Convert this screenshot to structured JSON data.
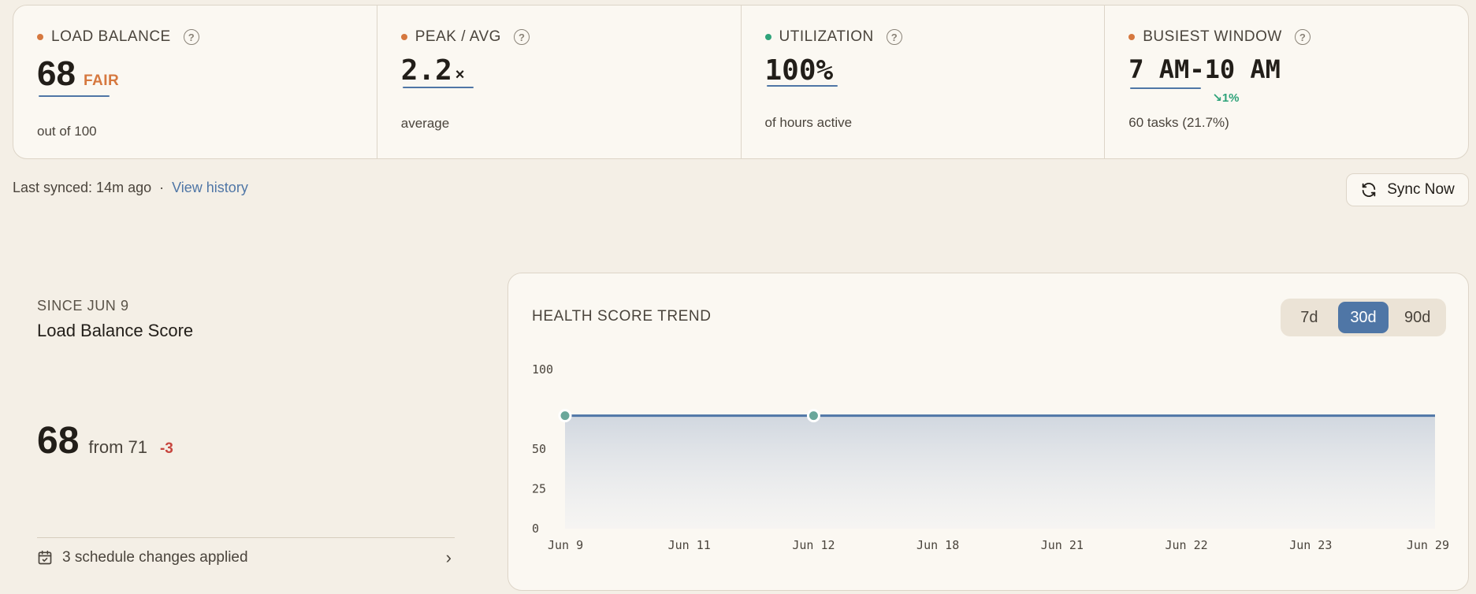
{
  "kpis": [
    {
      "label": "LOAD BALANCE",
      "dot_color": "#d6783f",
      "value": "68",
      "status": "FAIR",
      "status_color": "#d6783f",
      "sub": "out of 100"
    },
    {
      "label": "PEAK / AVG",
      "dot_color": "#d6783f",
      "value": "2.2",
      "unit": "×",
      "sub": "average"
    },
    {
      "label": "UTILIZATION",
      "dot_color": "#2fa37a",
      "value": "100%",
      "sub": "of hours active"
    },
    {
      "label": "BUSIEST WINDOW",
      "dot_color": "#d6783f",
      "value": "7 AM-10 AM",
      "delta": "1%",
      "sub": "60 tasks (21.7%)"
    }
  ],
  "sync": {
    "last_synced": "Last synced: 14m ago",
    "separator": "·",
    "history_link": "View history",
    "button": "Sync Now"
  },
  "summary": {
    "since": "SINCE JUN 9",
    "title": "Load Balance Score",
    "score": "68",
    "from": "from 71",
    "delta": "-3",
    "changes": "3 schedule changes applied"
  },
  "chart": {
    "title": "HEALTH SCORE TREND",
    "ranges": [
      "7d",
      "30d",
      "90d"
    ],
    "active_range": "30d"
  },
  "chart_data": {
    "type": "area",
    "title": "HEALTH SCORE TREND",
    "x": [
      "Jun 9",
      "Jun 11",
      "Jun 12",
      "Jun 18",
      "Jun 21",
      "Jun 22",
      "Jun 23",
      "Jun 29"
    ],
    "series": [
      {
        "values": [
          71,
          71,
          71,
          71,
          71,
          71,
          71,
          71
        ]
      }
    ],
    "markers": [
      "Jun 9",
      "Jun 12"
    ],
    "y_ticks": [
      0,
      25,
      50,
      100
    ],
    "ylim": [
      0,
      100
    ],
    "grid": false,
    "colors": {
      "line": "#4f76a6",
      "marker": "#6aa79b"
    }
  }
}
